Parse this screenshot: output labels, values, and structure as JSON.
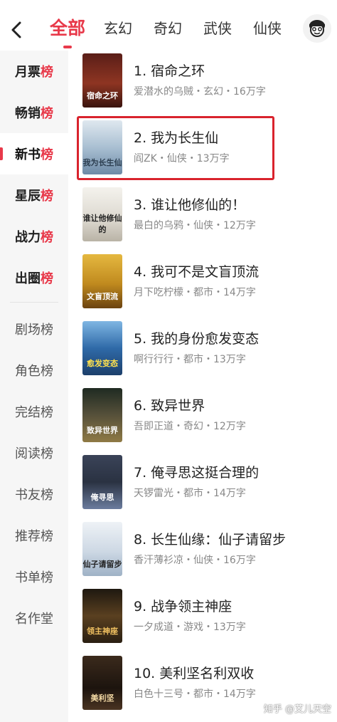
{
  "header": {
    "tabs": [
      {
        "label": "全部",
        "active": true
      },
      {
        "label": "玄幻",
        "active": false
      },
      {
        "label": "奇幻",
        "active": false
      },
      {
        "label": "武侠",
        "active": false
      },
      {
        "label": "仙侠",
        "active": false
      }
    ]
  },
  "sidebar": {
    "items": [
      {
        "prefix": "月票",
        "suffix": "榜"
      },
      {
        "prefix": "畅销",
        "suffix": "榜"
      },
      {
        "prefix": "新书",
        "suffix": "榜"
      },
      {
        "prefix": "星辰",
        "suffix": "榜"
      },
      {
        "prefix": "战力",
        "suffix": "榜"
      },
      {
        "prefix": "出圈",
        "suffix": "榜"
      },
      {
        "label": "剧场榜"
      },
      {
        "label": "角色榜"
      },
      {
        "label": "完结榜"
      },
      {
        "label": "阅读榜"
      },
      {
        "label": "书友榜"
      },
      {
        "label": "推荐榜"
      },
      {
        "label": "书单榜"
      },
      {
        "label": "名作堂"
      }
    ]
  },
  "books": [
    {
      "title": "1. 宿命之环",
      "meta": "爱潜水的乌贼・玄幻・16万字",
      "cover_text": "宿命之环"
    },
    {
      "title": "2. 我为长生仙",
      "meta": "阎ZK・仙侠・13万字",
      "cover_text": "我为长生仙"
    },
    {
      "title": "3. 谁让他修仙的！",
      "meta": "最白的乌鸦・仙侠・12万字",
      "cover_text": "谁让他修仙的"
    },
    {
      "title": "4. 我可不是文盲顶流",
      "meta": "月下吃柠檬・都市・14万字",
      "cover_text": "文盲顶流"
    },
    {
      "title": "5. 我的身份愈发变态",
      "meta": "啊行行行・都市・13万字",
      "cover_text": "愈发变态"
    },
    {
      "title": "6. 致异世界",
      "meta": "吾即正道・奇幻・12万字",
      "cover_text": "致异世界"
    },
    {
      "title": "7. 俺寻思这挺合理的",
      "meta": "天锣雷光・都市・14万字",
      "cover_text": "俺寻思"
    },
    {
      "title": "8. 长生仙缘：仙子请留步",
      "meta": "香汗薄衫凉・仙侠・16万字",
      "cover_text": "仙子请留步"
    },
    {
      "title": "9. 战争领主神座",
      "meta": "一夕成道・游戏・13万字",
      "cover_text": "领主神座"
    },
    {
      "title": "10. 美利坚名利双收",
      "meta": "白色十三号・都市・14万字",
      "cover_text": "美利坚"
    }
  ],
  "colors": {
    "accent": "#e8394a",
    "highlight_box": "#d9232d",
    "covers": [
      "#7a2a1f",
      "#b9c9d8",
      "#e9e6df",
      "#c99522",
      "#2f6aa8",
      "#3b3a30",
      "#2a3242",
      "#dfe6ee",
      "#3c2c18",
      "#2a1f16"
    ]
  },
  "watermark": "知乎 @艾儿天空"
}
